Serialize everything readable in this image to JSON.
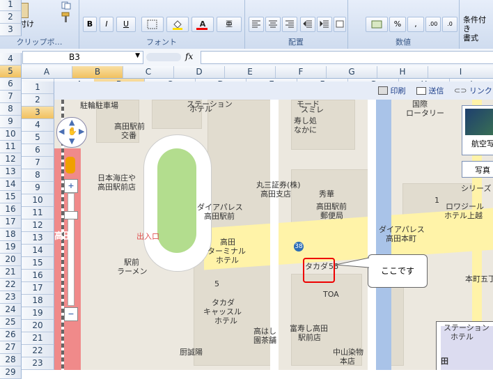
{
  "ribbon": {
    "clipboard": {
      "paste": "貼り付け",
      "label": "クリップボ…"
    },
    "font": {
      "bold": "B",
      "italic": "I",
      "underline": "U",
      "label": "フォント"
    },
    "alignment": {
      "label": "配置"
    },
    "number": {
      "percent": "%",
      "comma": ",",
      "label": "数値"
    },
    "styles": {
      "conditional": "条件付き",
      "format": "書式"
    }
  },
  "formula_bar": {
    "name_box": "B3",
    "fx": "fx"
  },
  "columns_top": [
    "A",
    "B",
    "C",
    "D",
    "E",
    "F",
    "G",
    "H",
    "I"
  ],
  "rows_left": [
    "1",
    "2",
    "3",
    "4",
    "5",
    "6",
    "7",
    "8",
    "9",
    "10",
    "11",
    "12",
    "13",
    "14",
    "15",
    "16",
    "17",
    "18",
    "19",
    "20",
    "21",
    "22",
    "23",
    "24",
    "25",
    "26",
    "27",
    "28",
    "29"
  ],
  "embed": {
    "columns": [
      "A",
      "B",
      "C",
      "D",
      "E",
      "F",
      "G",
      "H",
      "I"
    ],
    "rows": [
      "1",
      "2",
      "3",
      "4",
      "5",
      "6",
      "7",
      "8",
      "9",
      "10",
      "11",
      "12",
      "13",
      "14",
      "15",
      "16",
      "17",
      "18",
      "19",
      "20",
      "21",
      "22",
      "23"
    ],
    "toolbar": {
      "print": "印刷",
      "send": "送信",
      "link": "リンク"
    },
    "map": {
      "aerial": "航空写真",
      "photo": "写真",
      "callout": "ここです",
      "labels": {
        "bike_parking": "駐輪駐車場",
        "station_hotel_top": "ステーション",
        "hotel_top": "ホテル",
        "koban": "高田駅前",
        "koban2": "交番",
        "mode_smile1": "モード",
        "mode_smile2": "スミレ",
        "sushi1": "寿し処",
        "sushi2": "なかに",
        "kokusai1": "国際",
        "kokusai2": "ロータリー",
        "nihonkai1": "日本海庄や",
        "nihonkai2": "高田駅前店",
        "marusan1": "丸三証券(株)",
        "marusan2": "高田支店",
        "shuei": "秀華",
        "daiya1": "ダイアパレス",
        "daiya2": "高田駅前",
        "yubin1": "高田駅前",
        "yubin2": "郵便局",
        "royal1": "ロワジール",
        "royal2": "ホテル上越",
        "daiya3": "ダイアパレス",
        "daiya4": "高田本町",
        "takada": "高田",
        "exit": "出入口",
        "terminal1": "高田",
        "terminal2": "ターミナル",
        "terminal3": "ホテル",
        "route38": "38",
        "takada_num": "タカダ",
        "num56": "56",
        "ekimae1": "駅前",
        "ekimae2": "ラーメン",
        "toa": "TOA",
        "motomachi": "本町五丁",
        "takada_castle1": "タカダ",
        "takada_castle2": "キャッスル",
        "takada_castle3": "ホテル",
        "takahashi1": "高はし",
        "takahashi2": "園茶舗",
        "tomi1": "富寿し高田",
        "tomi2": "駅前店",
        "nakayama1": "中山染物",
        "nakayama2": "本店",
        "katsu": "厨誠陽",
        "num5": "5",
        "num1": "1",
        "series": "シリーズ",
        "station_hotel_bottom1": "ステーション",
        "station_hotel_bottom2": "ホテル",
        "den": "田"
      }
    }
  }
}
